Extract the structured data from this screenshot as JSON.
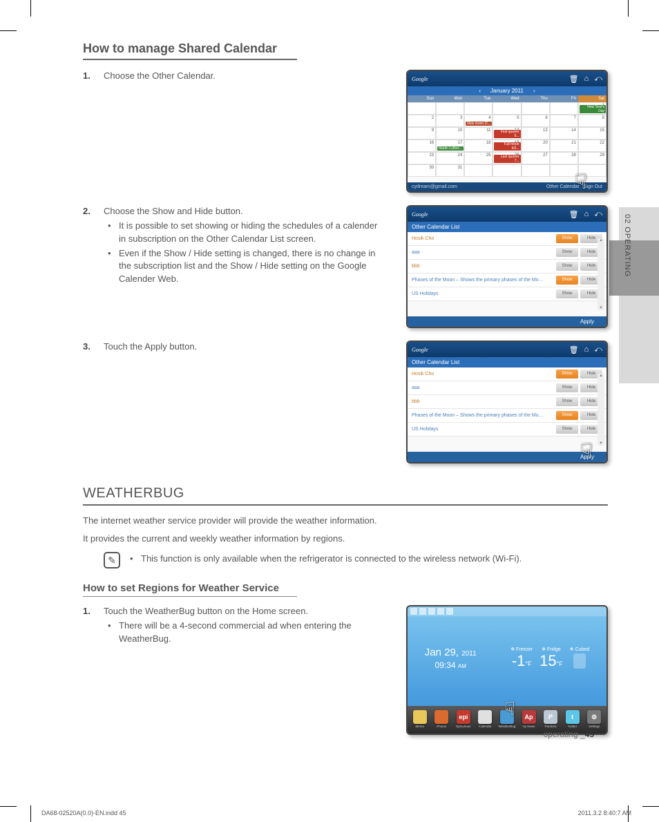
{
  "side_tab": "02  OPERATING",
  "section1": {
    "title": "How to manage Shared Calendar",
    "steps": [
      {
        "num": "1.",
        "text": "Choose the Other Calendar."
      },
      {
        "num": "2.",
        "text": "Choose the Show and Hide button.",
        "bullets": [
          "It is possible to set showing or hiding the schedules of a calender in subscription on the Other Calendar List screen.",
          "Even if the Show / Hide setting is changed, there is no change in the subscription list and the Show / Hide setting on the Google Calender Web."
        ]
      },
      {
        "num": "3.",
        "text": "Touch the Apply button."
      }
    ]
  },
  "fig_cal": {
    "brand": "Google",
    "month": "January 2011",
    "days": [
      "Sun",
      "Mon",
      "Tue",
      "Wed",
      "Thu",
      "Fri",
      "Sat"
    ],
    "footer_email": "cydream@gmail.com",
    "footer_other": "Other Calendar",
    "footer_signout": "Sign Out",
    "events": {
      "new_moon": "New moon 2/...",
      "first_q": "First quarter 6...",
      "mlk": "Martin Luther...",
      "full_moon": "Full moon 4/2...",
      "last_q": "Last quarter 7...",
      "nyd": "New Year's Day"
    }
  },
  "fig_list": {
    "title": "Other Calendar List",
    "rows": [
      {
        "name": "Hosik Cho",
        "cls": ""
      },
      {
        "name": "aaa",
        "cls": "blue"
      },
      {
        "name": "bbb",
        "cls": ""
      },
      {
        "name": "Phases of the Moon – Shows the primary phases of the Mo…",
        "cls": "blue"
      },
      {
        "name": "US Holidays",
        "cls": "blue"
      }
    ],
    "show": "Show",
    "hide": "Hide",
    "apply": "Apply"
  },
  "section2": {
    "heading": "WEATHERBUG",
    "intro1": "The internet weather service provider will provide the weather information.",
    "intro2": "It provides the current and weekly weather information by regions.",
    "note_bullet": "This function is only available when the refrigerator is connected to the wireless network (Wi-Fi).",
    "sub_title": "How to set Regions for Weather Service",
    "step1_num": "1.",
    "step1_text": "Touch the WeatherBug button on the Home screen.",
    "step1_bullet": "There will be a 4-second commercial ad when entering the WeatherBug."
  },
  "fig_home": {
    "date": "Jan 29,",
    "year": "2011",
    "time": "09:34",
    "ampm": "AM",
    "labels": {
      "freezer": "Freezer",
      "fridge": "Fridge",
      "cubed": "Cubed"
    },
    "t1": "-1",
    "t2": "15",
    "unit": "°F",
    "apps": [
      "Memo",
      "Photos",
      "Epicurious",
      "Calendar",
      "WeatherBug",
      "Ap News",
      "Pandora",
      "Twitter",
      "Settings"
    ],
    "app_colors": [
      "#e9c85a",
      "#d96b2e",
      "#c43a2e",
      "#e0e0e0",
      "#4a9bd4",
      "#b83a3a",
      "#bcc7d4",
      "#5cc6e8",
      "#7a7a7a"
    ],
    "app_short": [
      "",
      "",
      "epi",
      "",
      "",
      "Ap",
      "P",
      "t",
      "⚙"
    ]
  },
  "footer": {
    "label": "operating _",
    "page": "45"
  },
  "meta": {
    "left": "DA68-02520A(0.0)-EN.indd   45",
    "right": "2011.3.2   8:40:7 AM"
  }
}
